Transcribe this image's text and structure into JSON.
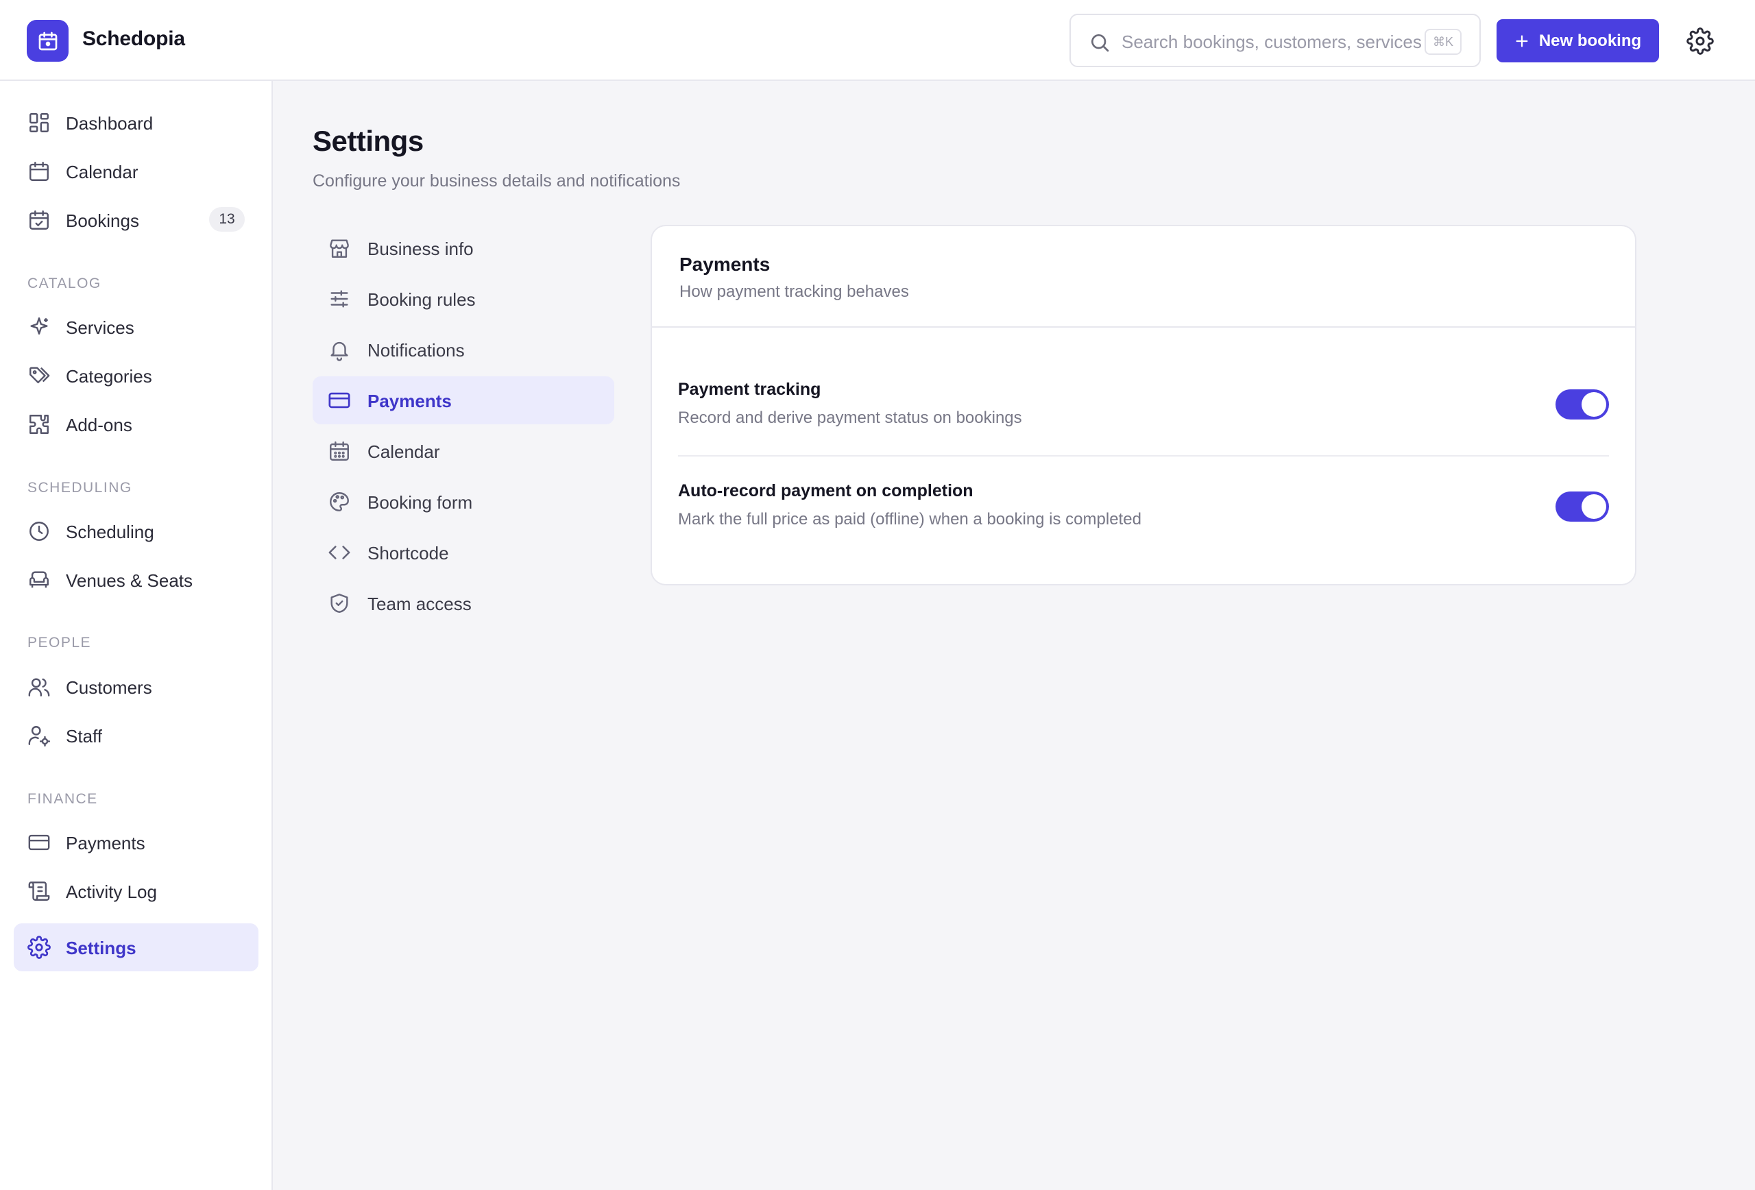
{
  "app": {
    "name": "Schedopia"
  },
  "colors": {
    "accent": "#4a3fe0",
    "active_bg": "#ebebfd",
    "active_text": "#3f36c9"
  },
  "header": {
    "search_placeholder": "Search bookings, customers, services",
    "search_shortcut": "⌘K",
    "new_booking_label": "New booking"
  },
  "sidebar": {
    "top": [
      {
        "label": "Dashboard",
        "icon": "dashboard-icon"
      },
      {
        "label": "Calendar",
        "icon": "calendar-icon"
      },
      {
        "label": "Bookings",
        "icon": "calendar-check-icon",
        "badge": "13"
      }
    ],
    "sections": {
      "catalog": "CATALOG",
      "scheduling": "SCHEDULING",
      "people": "PEOPLE",
      "finance": "FINANCE"
    },
    "catalog": [
      {
        "label": "Services",
        "icon": "sparkle-icon"
      },
      {
        "label": "Categories",
        "icon": "tags-icon"
      },
      {
        "label": "Add-ons",
        "icon": "puzzle-icon"
      }
    ],
    "scheduling": [
      {
        "label": "Scheduling",
        "icon": "clock-icon"
      },
      {
        "label": "Venues & Seats",
        "icon": "armchair-icon"
      }
    ],
    "people": [
      {
        "label": "Customers",
        "icon": "users-icon"
      },
      {
        "label": "Staff",
        "icon": "user-cog-icon"
      }
    ],
    "finance": [
      {
        "label": "Payments",
        "icon": "credit-card-icon"
      },
      {
        "label": "Activity Log",
        "icon": "scroll-icon"
      }
    ],
    "settings": {
      "label": "Settings",
      "icon": "gear-icon",
      "active": true
    }
  },
  "main": {
    "title": "Settings",
    "subtitle": "Configure your business details and notifications",
    "settings_nav": [
      {
        "label": "Business info",
        "icon": "store-icon"
      },
      {
        "label": "Booking rules",
        "icon": "sliders-icon"
      },
      {
        "label": "Notifications",
        "icon": "bell-icon"
      },
      {
        "label": "Payments",
        "icon": "credit-card-icon",
        "active": true
      },
      {
        "label": "Calendar",
        "icon": "calendar-grid-icon"
      },
      {
        "label": "Booking form",
        "icon": "palette-icon"
      },
      {
        "label": "Shortcode",
        "icon": "code-icon"
      },
      {
        "label": "Team access",
        "icon": "shield-check-icon"
      }
    ],
    "card": {
      "title": "Payments",
      "subtitle": "How payment tracking behaves",
      "rows": [
        {
          "title": "Payment tracking",
          "desc": "Record and derive payment status on bookings",
          "enabled": true
        },
        {
          "title": "Auto-record payment on completion",
          "desc": "Mark the full price as paid (offline) when a booking is completed",
          "enabled": true
        }
      ]
    }
  }
}
